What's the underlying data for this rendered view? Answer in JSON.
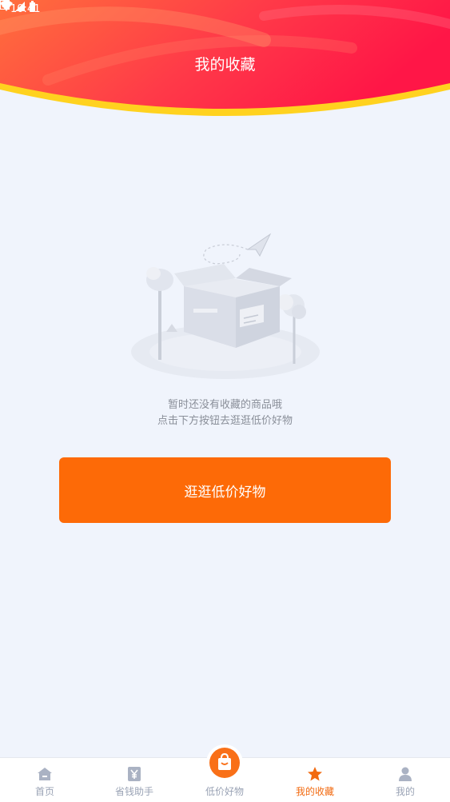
{
  "status_bar": {
    "time": "10:41",
    "notification_icon": "app-notification-icon",
    "icons": [
      "wifi-icon",
      "signal-icon",
      "battery-icon"
    ]
  },
  "header": {
    "title": "我的收藏",
    "colors": {
      "gradient_start": "#ff6b3d",
      "gradient_end": "#ff1a4a",
      "wave": "#ffd21f"
    }
  },
  "empty_state": {
    "illustration": "empty-box-illustration",
    "line1": "暂时还没有收藏的商品哦",
    "line2": "点击下方按钮去逛逛低价好物"
  },
  "browse_button": {
    "label": "逛逛低价好物",
    "color": "#fd6a07"
  },
  "tabbar": {
    "items": [
      {
        "label": "首页",
        "icon": "home-icon",
        "active": false
      },
      {
        "label": "省钱助手",
        "icon": "yuan-icon",
        "active": false
      },
      {
        "label": "低价好物",
        "icon": "shopping-bag-icon",
        "active": false
      },
      {
        "label": "我的收藏",
        "icon": "star-icon",
        "active": true
      },
      {
        "label": "我的",
        "icon": "user-icon",
        "active": false
      }
    ],
    "active_color": "#f26a10",
    "inactive_color": "#9aa3b5"
  }
}
